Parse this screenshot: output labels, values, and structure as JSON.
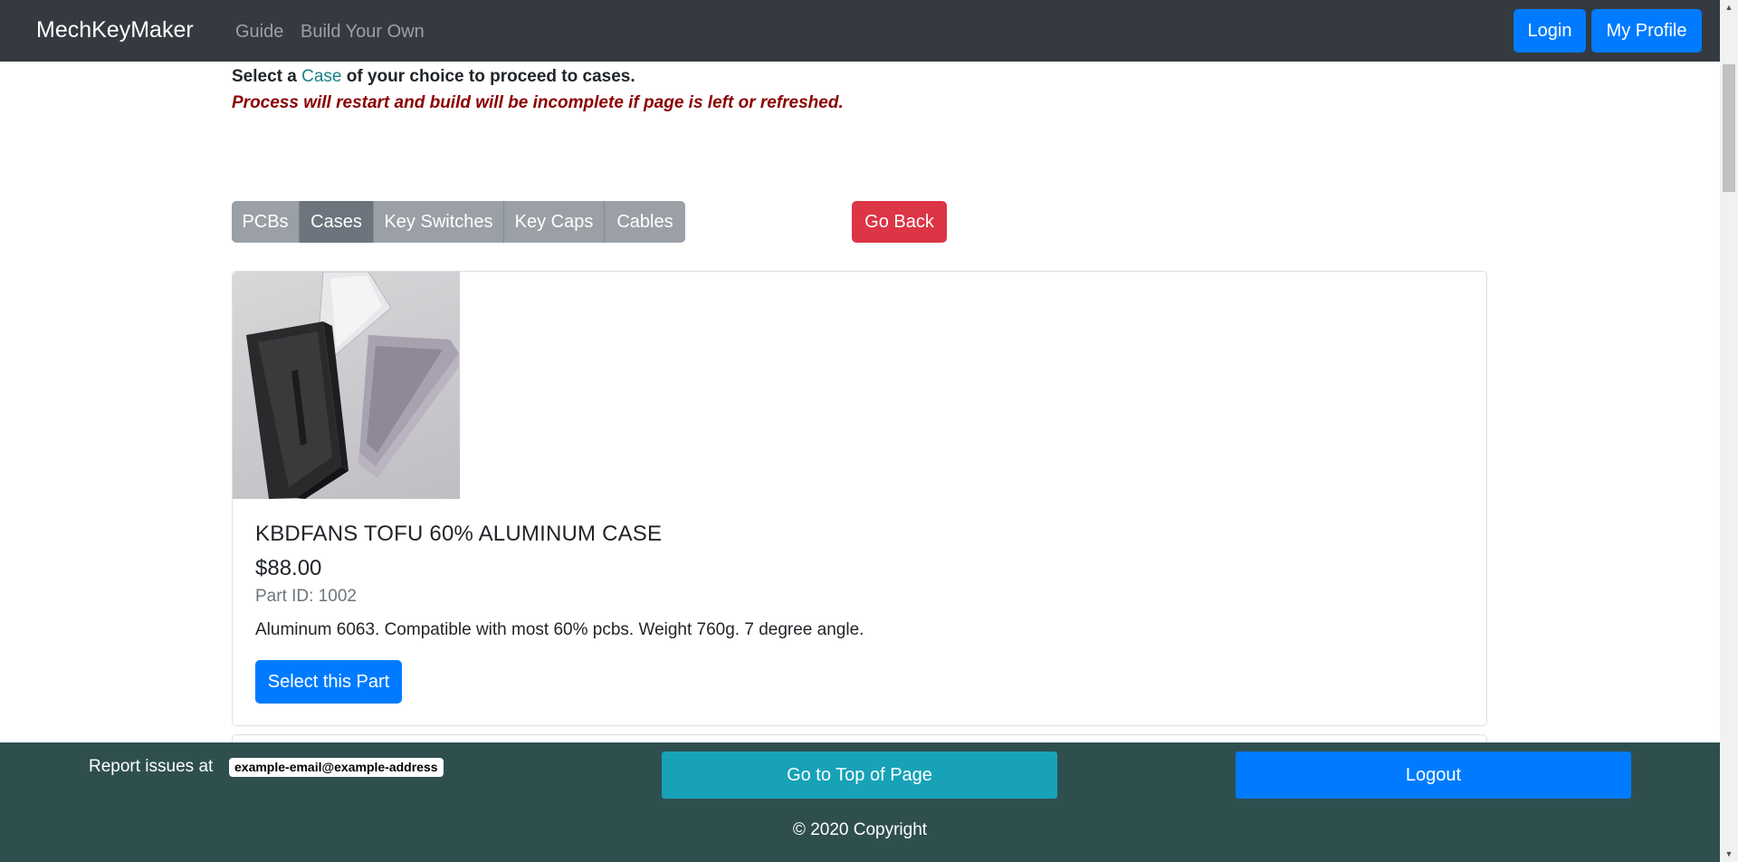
{
  "navbar": {
    "brand": "MechKeyMaker",
    "links": [
      "Guide",
      "Build Your Own"
    ],
    "login_label": "Login",
    "profile_label": "My Profile"
  },
  "instructions": {
    "prefix": "Select a ",
    "highlight": "Case",
    "suffix": " of your choice to proceed to cases.",
    "warning": "Process will restart and build will be incomplete if page is left or refreshed."
  },
  "tabs": [
    {
      "label": "PCBs",
      "active": false
    },
    {
      "label": "Cases",
      "active": true
    },
    {
      "label": "Key Switches",
      "active": false
    },
    {
      "label": "Key Caps",
      "active": false
    },
    {
      "label": "Cables",
      "active": false
    }
  ],
  "go_back_label": "Go Back",
  "product": {
    "title": "KBDFANS TOFU 60% ALUMINUM CASE",
    "price": "$88.00",
    "part_id": "Part ID: 1002",
    "description": "Aluminum 6063. Compatible with most 60% pcbs. Weight 760g. 7 degree angle.",
    "select_label": "Select this Part"
  },
  "footer": {
    "report_label": "Report issues at",
    "email": "example-email@example-address",
    "top_label": "Go to Top of Page",
    "logout_label": "Logout",
    "copyright": "© 2020 Copyright"
  },
  "colors": {
    "navbar": "#343a40",
    "primary": "#007bff",
    "danger": "#dc3545",
    "info": "#17a2b8",
    "footer": "#2f4f4f",
    "tab_inactive": "#9aa0a6",
    "tab_active": "#6c757d",
    "warning_text": "#8b0000",
    "accent_text": "#17808a"
  }
}
